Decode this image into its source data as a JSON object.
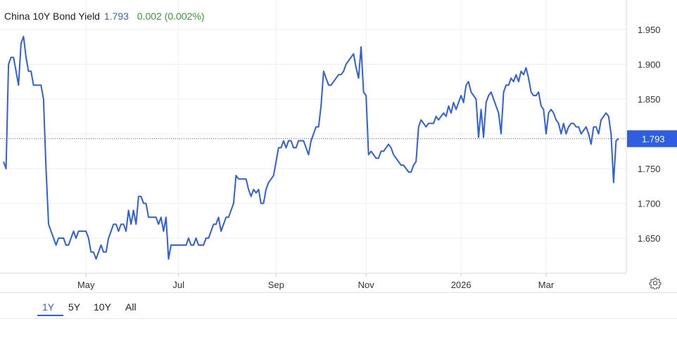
{
  "header": {
    "title": "China 10Y Bond Yield",
    "value": "1.793",
    "change": "0.002 (0.002%)"
  },
  "current_label": "1.793",
  "tabs": [
    {
      "label": "1Y",
      "active": true
    },
    {
      "label": "5Y",
      "active": false
    },
    {
      "label": "10Y",
      "active": false
    },
    {
      "label": "All",
      "active": false
    }
  ],
  "colors": {
    "line": "#2f5fe0",
    "positive": "#2aa32a",
    "grid": "#eeeeee",
    "axis_text": "#333333"
  },
  "icons": {
    "settings": "gear-icon"
  },
  "chart_data": {
    "type": "line",
    "series": [
      {
        "values": [
          1.76,
          1.75,
          1.9,
          1.91,
          1.91,
          1.89,
          1.87,
          1.93,
          1.94,
          1.91,
          1.89,
          1.89,
          1.87,
          1.87,
          1.87,
          1.87,
          1.85,
          1.75,
          1.67,
          1.66,
          1.65,
          1.64,
          1.65,
          1.65,
          1.65,
          1.64,
          1.64,
          1.65,
          1.66,
          1.65,
          1.66,
          1.66,
          1.66,
          1.66,
          1.65,
          1.63,
          1.63,
          1.62,
          1.63,
          1.64,
          1.63,
          1.63,
          1.65,
          1.66,
          1.67,
          1.67,
          1.66,
          1.67,
          1.67,
          1.66,
          1.69,
          1.67,
          1.69,
          1.67,
          1.71,
          1.71,
          1.7,
          1.7,
          1.68,
          1.68,
          1.68,
          1.68,
          1.67,
          1.68,
          1.66,
          1.68,
          1.62,
          1.64,
          1.64,
          1.64,
          1.64,
          1.64,
          1.64,
          1.64,
          1.65,
          1.64,
          1.64,
          1.65,
          1.64,
          1.64,
          1.64,
          1.65,
          1.65,
          1.66,
          1.67,
          1.67,
          1.68,
          1.66,
          1.67,
          1.68,
          1.68,
          1.69,
          1.7,
          1.74,
          1.735,
          1.735,
          1.735,
          1.735,
          1.72,
          1.71,
          1.72,
          1.715,
          1.72,
          1.7,
          1.7,
          1.72,
          1.73,
          1.735,
          1.74,
          1.76,
          1.78,
          1.78,
          1.79,
          1.78,
          1.79,
          1.79,
          1.78,
          1.78,
          1.79,
          1.79,
          1.79,
          1.78,
          1.77,
          1.79,
          1.8,
          1.81,
          1.81,
          1.84,
          1.89,
          1.88,
          1.87,
          1.87,
          1.875,
          1.88,
          1.885,
          1.885,
          1.89,
          1.9,
          1.905,
          1.91,
          1.915,
          1.895,
          1.88,
          1.925,
          1.86,
          1.855,
          1.77,
          1.775,
          1.77,
          1.765,
          1.765,
          1.775,
          1.775,
          1.78,
          1.785,
          1.78,
          1.77,
          1.765,
          1.76,
          1.755,
          1.755,
          1.75,
          1.745,
          1.745,
          1.755,
          1.76,
          1.81,
          1.82,
          1.815,
          1.81,
          1.815,
          1.815,
          1.815,
          1.825,
          1.82,
          1.825,
          1.83,
          1.825,
          1.84,
          1.83,
          1.845,
          1.835,
          1.845,
          1.855,
          1.845,
          1.87,
          1.875,
          1.86,
          1.855,
          1.85,
          1.795,
          1.835,
          1.795,
          1.845,
          1.855,
          1.86,
          1.85,
          1.84,
          1.83,
          1.8,
          1.86,
          1.87,
          1.87,
          1.88,
          1.875,
          1.885,
          1.875,
          1.89,
          1.885,
          1.895,
          1.88,
          1.86,
          1.855,
          1.855,
          1.86,
          1.84,
          1.835,
          1.8,
          1.83,
          1.835,
          1.83,
          1.82,
          1.815,
          1.8,
          1.815,
          1.8,
          1.81,
          1.815,
          1.815,
          1.81,
          1.81,
          1.8,
          1.805,
          1.81,
          1.8,
          1.785,
          1.81,
          1.81,
          1.8,
          1.82,
          1.825,
          1.83,
          1.825,
          1.8,
          1.73,
          1.79,
          1.793
        ]
      }
    ],
    "x_tick_labels": [
      "May",
      "Jul",
      "Sep",
      "Nov",
      "2026",
      "Mar"
    ],
    "x_tick_positions_index": [
      33,
      70,
      109,
      145,
      183,
      217
    ],
    "y_ticks": [
      1.65,
      1.7,
      1.75,
      1.8,
      1.85,
      1.9,
      1.95
    ],
    "y_tick_labels": [
      "1.650",
      "1.700",
      "1.750",
      "1.800",
      "1.850",
      "1.900",
      "1.950"
    ],
    "ylim": [
      1.6,
      2.0
    ],
    "grid": true,
    "y_axis_side": "right",
    "current_value": 1.793
  }
}
